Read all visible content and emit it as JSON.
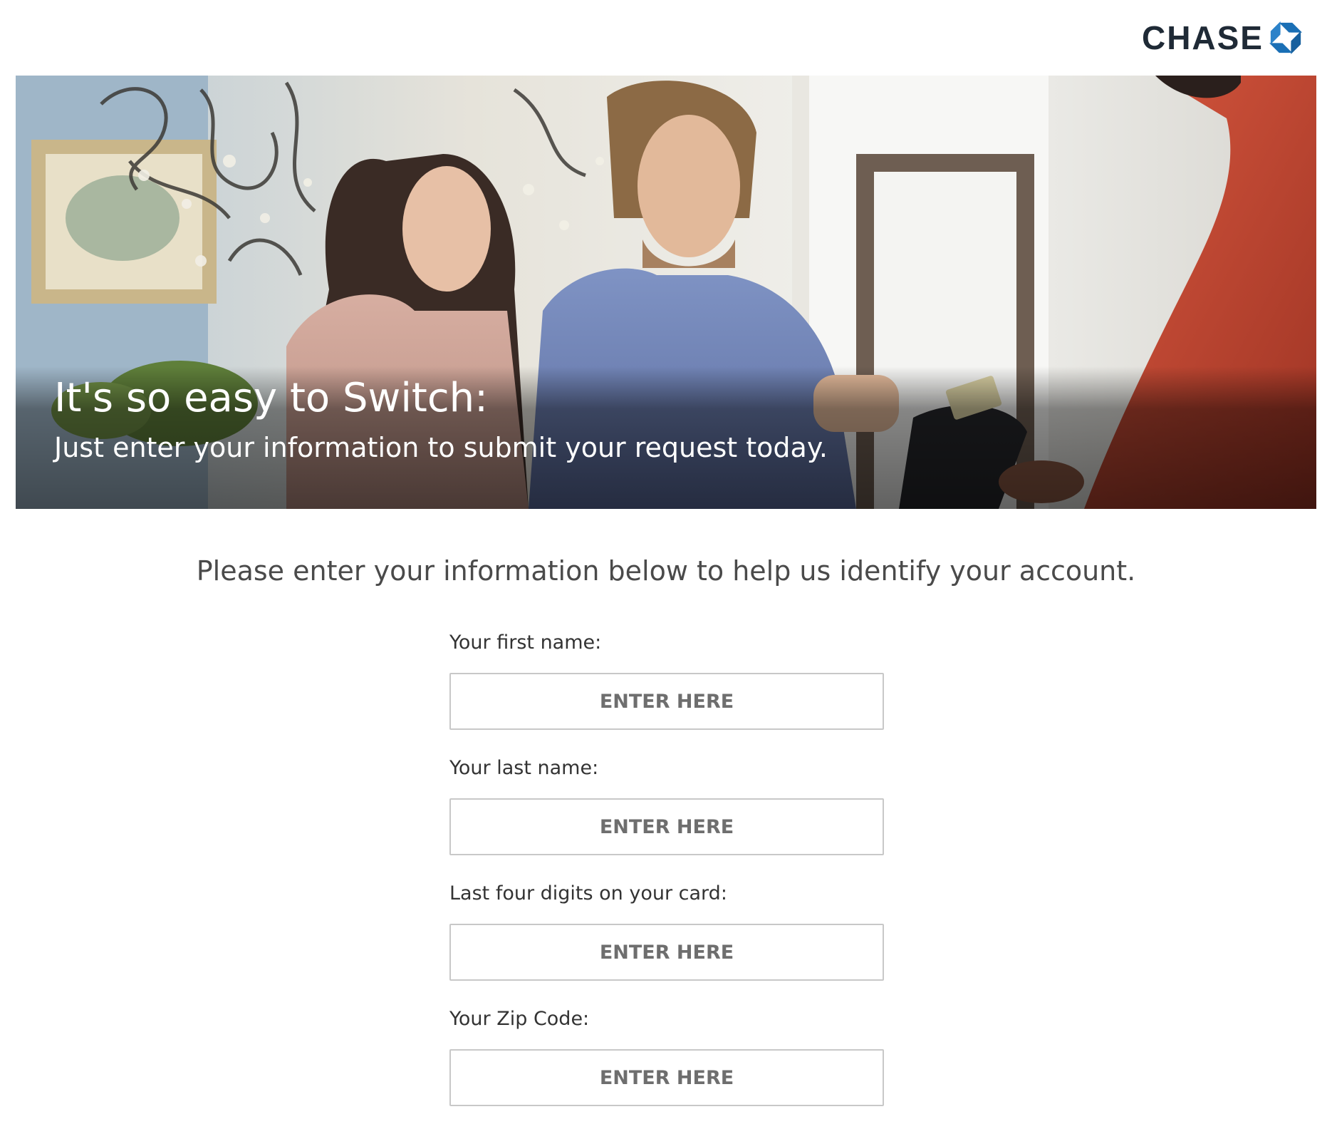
{
  "brand": {
    "name": "CHASE",
    "logo_icon": "chase-octagon-icon",
    "logo_color": "#1f2a36",
    "mark_color": "#1a6fb5"
  },
  "hero": {
    "image": "couple-paying-at-store-photo",
    "title": "It's so easy to Switch:",
    "subtitle": "Just enter your information to submit your request today."
  },
  "intro": {
    "text": "Please enter your information below to help us identify your account."
  },
  "form": {
    "fields": [
      {
        "label": "Your first name:",
        "placeholder": "ENTER HERE",
        "value": ""
      },
      {
        "label": "Your last name:",
        "placeholder": "ENTER HERE",
        "value": ""
      },
      {
        "label": "Last four digits on your card:",
        "placeholder": "ENTER HERE",
        "value": ""
      },
      {
        "label": "Your Zip Code:",
        "placeholder": "ENTER HERE",
        "value": ""
      }
    ]
  }
}
